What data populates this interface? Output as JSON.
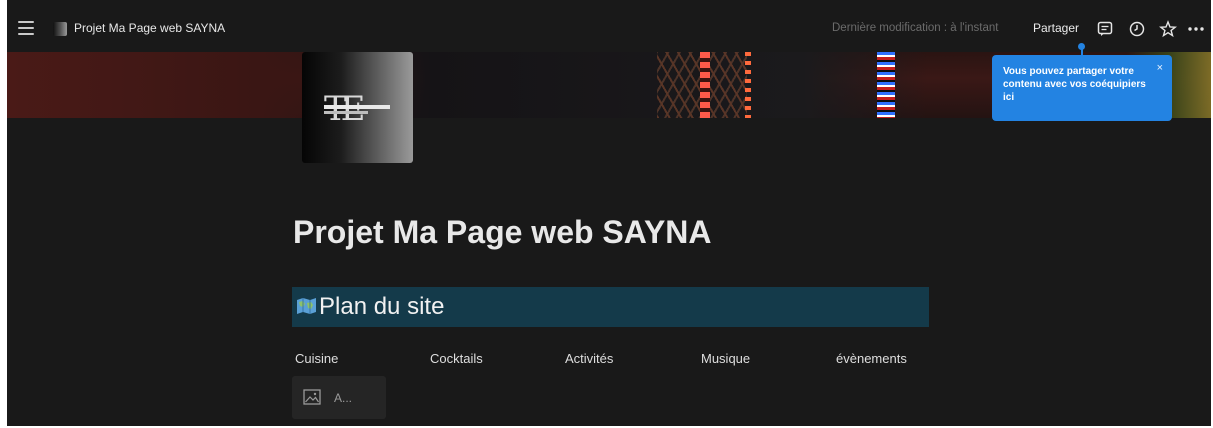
{
  "topbar": {
    "breadcrumb": "Projet Ma Page web SAYNA",
    "last_modified": "Dernière modification : à l'instant",
    "share_label": "Partager"
  },
  "tooltip": {
    "text": "Vous pouvez partager votre contenu avec vos coéquipiers ici",
    "close": "×"
  },
  "page": {
    "title": "Projet Ma Page web SAYNA",
    "section_heading": "Plan du site",
    "menu_items": [
      "Cuisine",
      "Cocktails",
      "Activités",
      "Musique",
      "évènements"
    ],
    "image_block_label": "A..."
  },
  "colors": {
    "background": "#191919",
    "accent_blue": "#2383e2",
    "section_bg": "#143a4a"
  }
}
